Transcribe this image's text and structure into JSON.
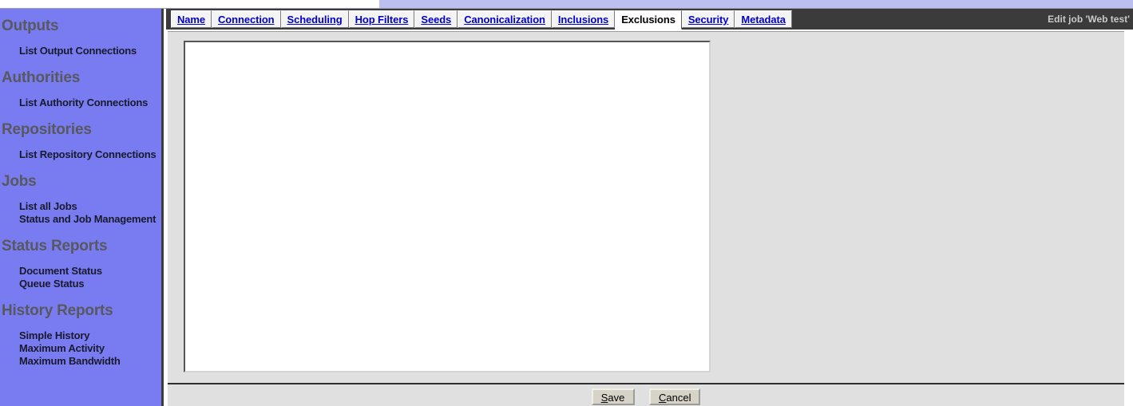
{
  "header": {
    "job_title": "Edit job 'Web test'"
  },
  "sidebar": {
    "sections": [
      {
        "heading": "Outputs",
        "links": [
          {
            "label": "List Output Connections"
          }
        ]
      },
      {
        "heading": "Authorities",
        "links": [
          {
            "label": "List Authority Connections"
          }
        ]
      },
      {
        "heading": "Repositories",
        "links": [
          {
            "label": "List Repository Connections"
          }
        ]
      },
      {
        "heading": "Jobs",
        "links": [
          {
            "label": "List all Jobs"
          },
          {
            "label": "Status and Job Management"
          }
        ]
      },
      {
        "heading": "Status Reports",
        "links": [
          {
            "label": "Document Status"
          },
          {
            "label": "Queue Status"
          }
        ]
      },
      {
        "heading": "History Reports",
        "links": [
          {
            "label": "Simple History"
          },
          {
            "label": "Maximum Activity"
          },
          {
            "label": "Maximum Bandwidth"
          }
        ]
      }
    ]
  },
  "tabs": [
    {
      "label": "Name",
      "active": false
    },
    {
      "label": "Connection",
      "active": false
    },
    {
      "label": "Scheduling",
      "active": false
    },
    {
      "label": "Hop Filters",
      "active": false
    },
    {
      "label": "Seeds",
      "active": false
    },
    {
      "label": "Canonicalization",
      "active": false
    },
    {
      "label": "Inclusions",
      "active": false
    },
    {
      "label": "Exclusions",
      "active": true
    },
    {
      "label": "Security",
      "active": false
    },
    {
      "label": "Metadata",
      "active": false
    }
  ],
  "main": {
    "exclusions_value": "",
    "exclusions_placeholder": ""
  },
  "buttons": {
    "save": {
      "accesskey": "S",
      "rest": "ave"
    },
    "cancel": {
      "accesskey": "C",
      "rest": "ancel"
    }
  },
  "colors": {
    "sidebar_bg": "#787cf0",
    "sidebar_heading": "#58585e",
    "tabbar_bg": "#3b3b3b",
    "tab_link": "#0000cc",
    "content_bg": "#e0e0e0",
    "top_strip_lavender": "#bcc0ee",
    "button_face": "#d6d3c8"
  }
}
